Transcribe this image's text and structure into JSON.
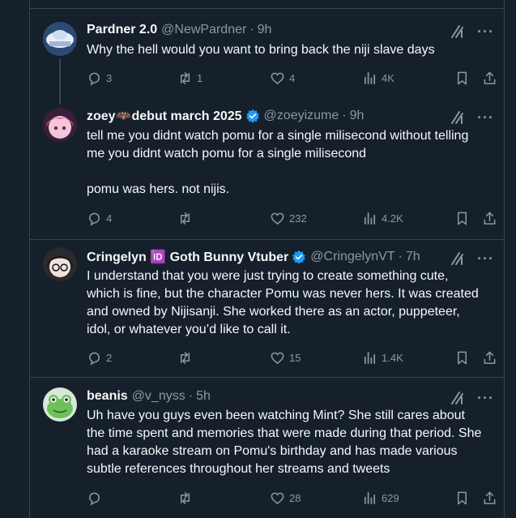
{
  "tweets": [
    {
      "name": "Pardner 2.0",
      "handle": "@NewPardner",
      "time": "9h",
      "verified": false,
      "text": "Why the hell would you want to bring back the niji slave days",
      "replies": "3",
      "reposts": "1",
      "likes": "4",
      "views": "4K"
    },
    {
      "name": "zoey🦇debut march 2025",
      "handle": "@zoeyizume",
      "time": "9h",
      "verified": true,
      "text": "tell me you didnt watch pomu for a single milisecond without telling me you didnt watch pomu for a single milisecond\n\npomu was hers. not nijis.",
      "replies": "4",
      "reposts": "",
      "likes": "232",
      "views": "4.2K"
    },
    {
      "name": "Cringelyn 🆔 Goth Bunny Vtuber",
      "handle": "@CringelynVT",
      "time": "7h",
      "verified": true,
      "text": "I understand that you were just trying to create something cute, which is fine, but the character Pomu was never hers. It was created and owned by Nijisanji. She worked there as an actor, puppeteer, idol, or whatever you’d like to call it.",
      "replies": "2",
      "reposts": "",
      "likes": "15",
      "views": "1.4K"
    },
    {
      "name": "beanis",
      "handle": "@v_nyss",
      "time": "5h",
      "verified": false,
      "text": "Uh have you guys even been watching Mint? She still cares about the time spent and memories that were made during that period. She had a karaoke stream on Pomu's birthday and has made various subtle references throughout her streams and tweets",
      "replies": "",
      "reposts": "",
      "likes": "28",
      "views": "629"
    }
  ],
  "colors": {
    "background": "#15202b",
    "border": "#38444d",
    "muted": "#8b98a5",
    "text": "#f7f9f9",
    "verified": "#1d9bf0"
  },
  "icons": [
    "grok-icon",
    "more-icon",
    "reply-icon",
    "repost-icon",
    "like-icon",
    "views-icon",
    "bookmark-icon",
    "share-icon",
    "verified-badge-icon"
  ],
  "separator": "·"
}
